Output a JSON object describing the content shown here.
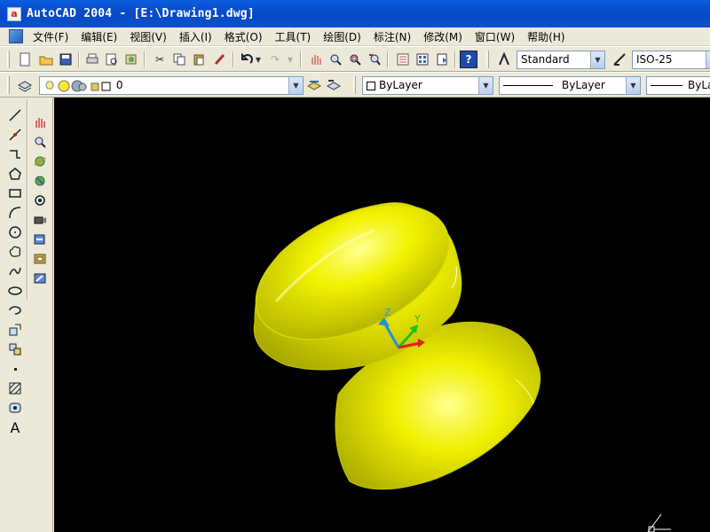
{
  "window": {
    "title": "AutoCAD 2004 - [E:\\Drawing1.dwg]",
    "app_icon": "a"
  },
  "menu": [
    "文件(F)",
    "编辑(E)",
    "视图(V)",
    "插入(I)",
    "格式(O)",
    "工具(T)",
    "绘图(D)",
    "标注(N)",
    "修改(M)",
    "窗口(W)",
    "帮助(H)"
  ],
  "styles_toolbar": {
    "text_style": "Standard",
    "dim_style": "ISO-25"
  },
  "layers_toolbar": {
    "current_layer": "0",
    "color": "ByLayer",
    "linetype": "ByLayer",
    "lineweight": "ByLay"
  },
  "colors": {
    "solid": "#e8e800",
    "viewport_bg": "#000000",
    "ucs_x": "#e02020",
    "ucs_y": "#20c020",
    "ucs_z": "#2090e0"
  },
  "ucs": {
    "z_label": "Z",
    "y_label": "Y"
  }
}
